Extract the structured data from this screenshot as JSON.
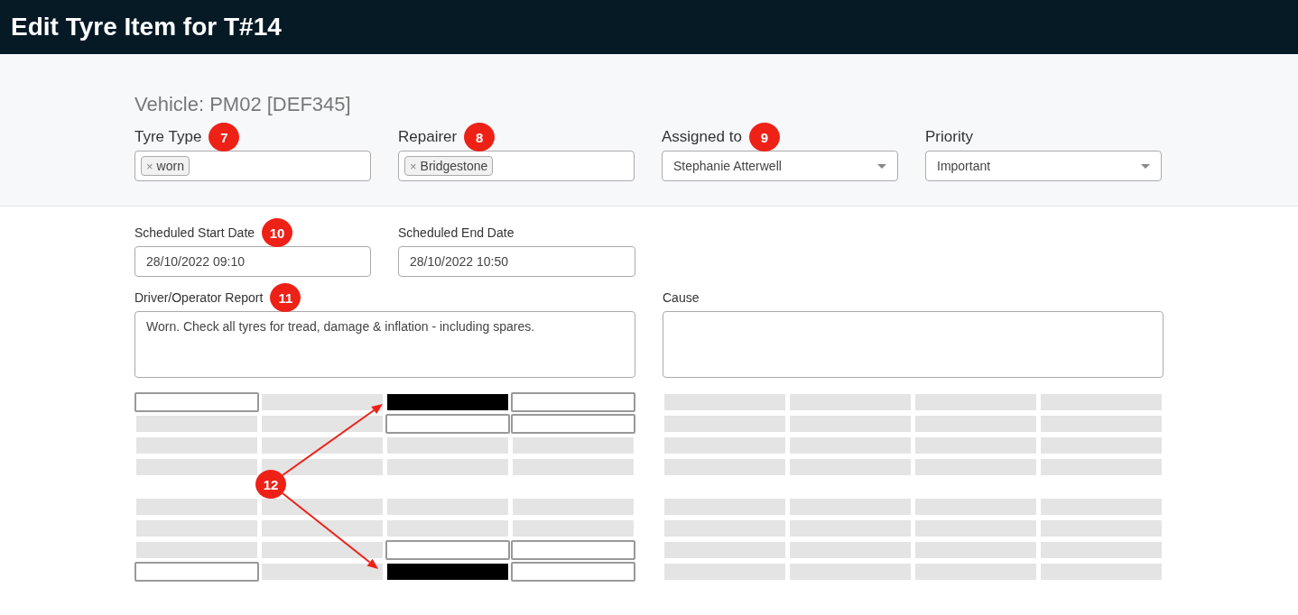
{
  "header": {
    "title": "Edit Tyre Item for T#14"
  },
  "vehicle": "Vehicle: PM02 [DEF345]",
  "top_fields": [
    {
      "kind": "tags",
      "label": "Tyre Type",
      "badge": "7",
      "tags": [
        {
          "remove": "×",
          "text": "worn"
        }
      ]
    },
    {
      "kind": "tags",
      "label": "Repairer",
      "badge": "8",
      "tags": [
        {
          "remove": "×",
          "text": "Bridgestone"
        }
      ]
    },
    {
      "kind": "select",
      "label": "Assigned to",
      "badge": "9",
      "value": "Stephanie Atterwell"
    },
    {
      "kind": "select",
      "label": "Priority",
      "value": "Important"
    }
  ],
  "dates": [
    {
      "label": "Scheduled Start Date",
      "badge": "10",
      "value": "28/10/2022 09:10"
    },
    {
      "label": "Scheduled End Date",
      "value": "28/10/2022 10:50"
    }
  ],
  "report": {
    "label": "Driver/Operator Report",
    "badge": "11",
    "value": "Worn. Check all tyres for tread, damage & inflation - including spares."
  },
  "cause": {
    "label": "Cause"
  },
  "tyre_grid": {
    "badge": "12",
    "panels": [
      {
        "axles": [
          {
            "rows": [
              [
                {
                  "kind": "outline"
                },
                {
                  "kind": "blank"
                },
                {
                  "kind": "dark"
                },
                {
                  "kind": "outline"
                }
              ],
              [
                {
                  "kind": "blank"
                },
                {
                  "kind": "blank"
                },
                {
                  "kind": "outline"
                },
                {
                  "kind": "outline"
                }
              ],
              [
                {
                  "kind": "blank"
                },
                {
                  "kind": "blank"
                },
                {
                  "kind": "blank"
                },
                {
                  "kind": "blank"
                }
              ],
              [
                {
                  "kind": "blank"
                },
                {
                  "kind": "blank"
                },
                {
                  "kind": "blank"
                },
                {
                  "kind": "blank"
                }
              ]
            ]
          },
          {
            "rows": [
              [
                {
                  "kind": "blank"
                },
                {
                  "kind": "blank"
                },
                {
                  "kind": "blank"
                },
                {
                  "kind": "blank"
                }
              ],
              [
                {
                  "kind": "blank"
                },
                {
                  "kind": "blank"
                },
                {
                  "kind": "blank"
                },
                {
                  "kind": "blank"
                }
              ],
              [
                {
                  "kind": "blank"
                },
                {
                  "kind": "blank"
                },
                {
                  "kind": "outline"
                },
                {
                  "kind": "outline"
                }
              ],
              [
                {
                  "kind": "outline"
                },
                {
                  "kind": "blank"
                },
                {
                  "kind": "dark"
                },
                {
                  "kind": "outline"
                }
              ]
            ]
          }
        ]
      },
      {
        "axles": [
          {
            "rows": [
              [
                {
                  "kind": "blank"
                },
                {
                  "kind": "blank"
                },
                {
                  "kind": "blank"
                },
                {
                  "kind": "blank"
                }
              ],
              [
                {
                  "kind": "blank"
                },
                {
                  "kind": "blank"
                },
                {
                  "kind": "blank"
                },
                {
                  "kind": "blank"
                }
              ],
              [
                {
                  "kind": "blank"
                },
                {
                  "kind": "blank"
                },
                {
                  "kind": "blank"
                },
                {
                  "kind": "blank"
                }
              ],
              [
                {
                  "kind": "blank"
                },
                {
                  "kind": "blank"
                },
                {
                  "kind": "blank"
                },
                {
                  "kind": "blank"
                }
              ]
            ]
          },
          {
            "rows": [
              [
                {
                  "kind": "blank"
                },
                {
                  "kind": "blank"
                },
                {
                  "kind": "blank"
                },
                {
                  "kind": "blank"
                }
              ],
              [
                {
                  "kind": "blank"
                },
                {
                  "kind": "blank"
                },
                {
                  "kind": "blank"
                },
                {
                  "kind": "blank"
                }
              ],
              [
                {
                  "kind": "blank"
                },
                {
                  "kind": "blank"
                },
                {
                  "kind": "blank"
                },
                {
                  "kind": "blank"
                }
              ],
              [
                {
                  "kind": "blank"
                },
                {
                  "kind": "blank"
                },
                {
                  "kind": "blank"
                },
                {
                  "kind": "blank"
                }
              ]
            ]
          }
        ]
      }
    ]
  }
}
